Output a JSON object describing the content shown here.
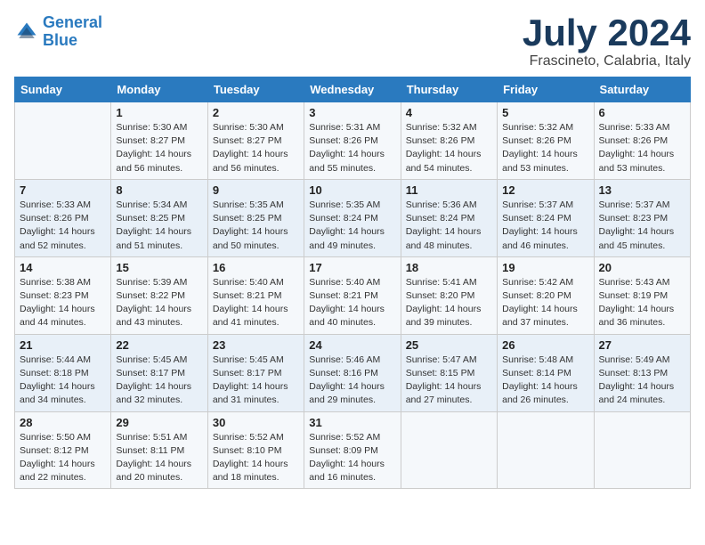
{
  "header": {
    "logo_line1": "General",
    "logo_line2": "Blue",
    "month_year": "July 2024",
    "location": "Frascineto, Calabria, Italy"
  },
  "weekdays": [
    "Sunday",
    "Monday",
    "Tuesday",
    "Wednesday",
    "Thursday",
    "Friday",
    "Saturday"
  ],
  "weeks": [
    [
      {
        "day": "",
        "info": ""
      },
      {
        "day": "1",
        "info": "Sunrise: 5:30 AM\nSunset: 8:27 PM\nDaylight: 14 hours\nand 56 minutes."
      },
      {
        "day": "2",
        "info": "Sunrise: 5:30 AM\nSunset: 8:27 PM\nDaylight: 14 hours\nand 56 minutes."
      },
      {
        "day": "3",
        "info": "Sunrise: 5:31 AM\nSunset: 8:26 PM\nDaylight: 14 hours\nand 55 minutes."
      },
      {
        "day": "4",
        "info": "Sunrise: 5:32 AM\nSunset: 8:26 PM\nDaylight: 14 hours\nand 54 minutes."
      },
      {
        "day": "5",
        "info": "Sunrise: 5:32 AM\nSunset: 8:26 PM\nDaylight: 14 hours\nand 53 minutes."
      },
      {
        "day": "6",
        "info": "Sunrise: 5:33 AM\nSunset: 8:26 PM\nDaylight: 14 hours\nand 53 minutes."
      }
    ],
    [
      {
        "day": "7",
        "info": "Sunrise: 5:33 AM\nSunset: 8:26 PM\nDaylight: 14 hours\nand 52 minutes."
      },
      {
        "day": "8",
        "info": "Sunrise: 5:34 AM\nSunset: 8:25 PM\nDaylight: 14 hours\nand 51 minutes."
      },
      {
        "day": "9",
        "info": "Sunrise: 5:35 AM\nSunset: 8:25 PM\nDaylight: 14 hours\nand 50 minutes."
      },
      {
        "day": "10",
        "info": "Sunrise: 5:35 AM\nSunset: 8:24 PM\nDaylight: 14 hours\nand 49 minutes."
      },
      {
        "day": "11",
        "info": "Sunrise: 5:36 AM\nSunset: 8:24 PM\nDaylight: 14 hours\nand 48 minutes."
      },
      {
        "day": "12",
        "info": "Sunrise: 5:37 AM\nSunset: 8:24 PM\nDaylight: 14 hours\nand 46 minutes."
      },
      {
        "day": "13",
        "info": "Sunrise: 5:37 AM\nSunset: 8:23 PM\nDaylight: 14 hours\nand 45 minutes."
      }
    ],
    [
      {
        "day": "14",
        "info": "Sunrise: 5:38 AM\nSunset: 8:23 PM\nDaylight: 14 hours\nand 44 minutes."
      },
      {
        "day": "15",
        "info": "Sunrise: 5:39 AM\nSunset: 8:22 PM\nDaylight: 14 hours\nand 43 minutes."
      },
      {
        "day": "16",
        "info": "Sunrise: 5:40 AM\nSunset: 8:21 PM\nDaylight: 14 hours\nand 41 minutes."
      },
      {
        "day": "17",
        "info": "Sunrise: 5:40 AM\nSunset: 8:21 PM\nDaylight: 14 hours\nand 40 minutes."
      },
      {
        "day": "18",
        "info": "Sunrise: 5:41 AM\nSunset: 8:20 PM\nDaylight: 14 hours\nand 39 minutes."
      },
      {
        "day": "19",
        "info": "Sunrise: 5:42 AM\nSunset: 8:20 PM\nDaylight: 14 hours\nand 37 minutes."
      },
      {
        "day": "20",
        "info": "Sunrise: 5:43 AM\nSunset: 8:19 PM\nDaylight: 14 hours\nand 36 minutes."
      }
    ],
    [
      {
        "day": "21",
        "info": "Sunrise: 5:44 AM\nSunset: 8:18 PM\nDaylight: 14 hours\nand 34 minutes."
      },
      {
        "day": "22",
        "info": "Sunrise: 5:45 AM\nSunset: 8:17 PM\nDaylight: 14 hours\nand 32 minutes."
      },
      {
        "day": "23",
        "info": "Sunrise: 5:45 AM\nSunset: 8:17 PM\nDaylight: 14 hours\nand 31 minutes."
      },
      {
        "day": "24",
        "info": "Sunrise: 5:46 AM\nSunset: 8:16 PM\nDaylight: 14 hours\nand 29 minutes."
      },
      {
        "day": "25",
        "info": "Sunrise: 5:47 AM\nSunset: 8:15 PM\nDaylight: 14 hours\nand 27 minutes."
      },
      {
        "day": "26",
        "info": "Sunrise: 5:48 AM\nSunset: 8:14 PM\nDaylight: 14 hours\nand 26 minutes."
      },
      {
        "day": "27",
        "info": "Sunrise: 5:49 AM\nSunset: 8:13 PM\nDaylight: 14 hours\nand 24 minutes."
      }
    ],
    [
      {
        "day": "28",
        "info": "Sunrise: 5:50 AM\nSunset: 8:12 PM\nDaylight: 14 hours\nand 22 minutes."
      },
      {
        "day": "29",
        "info": "Sunrise: 5:51 AM\nSunset: 8:11 PM\nDaylight: 14 hours\nand 20 minutes."
      },
      {
        "day": "30",
        "info": "Sunrise: 5:52 AM\nSunset: 8:10 PM\nDaylight: 14 hours\nand 18 minutes."
      },
      {
        "day": "31",
        "info": "Sunrise: 5:52 AM\nSunset: 8:09 PM\nDaylight: 14 hours\nand 16 minutes."
      },
      {
        "day": "",
        "info": ""
      },
      {
        "day": "",
        "info": ""
      },
      {
        "day": "",
        "info": ""
      }
    ]
  ]
}
